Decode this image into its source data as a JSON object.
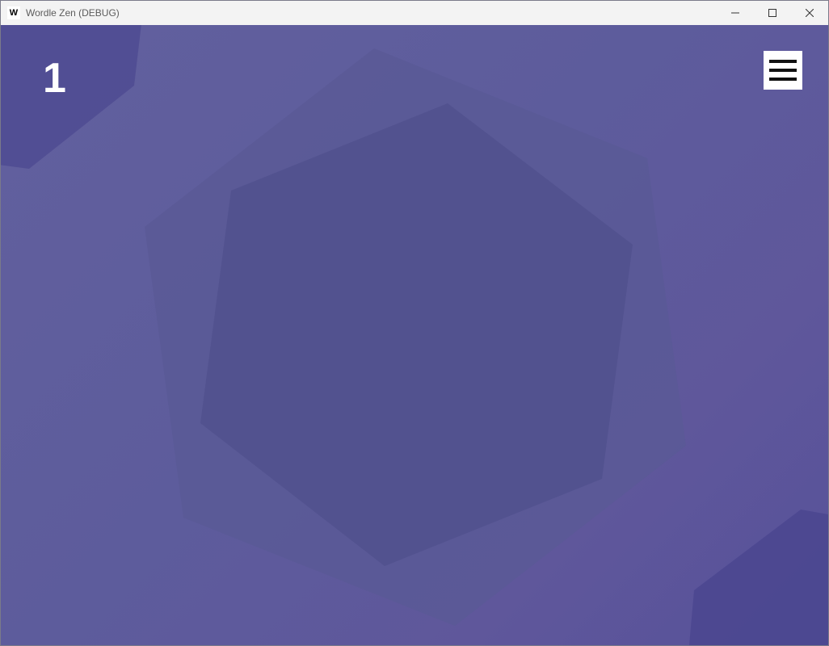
{
  "window": {
    "title": "Wordle Zen (DEBUG)",
    "app_icon_letter": "W"
  },
  "titlebar_icons": {
    "minimize": "minimize-icon",
    "maximize": "maximize-icon",
    "close": "close-icon"
  },
  "game": {
    "level": "1",
    "menu_icon": "hamburger-menu-icon"
  },
  "colors": {
    "background": "#5e5c9c",
    "hexagon_outer": "#5b5a98",
    "hexagon_inner": "#52518e",
    "corner_hexagon": "#4c4890",
    "menu_button_bg": "#ffffff",
    "menu_bars": "#111111",
    "level_text": "#ffffff"
  }
}
